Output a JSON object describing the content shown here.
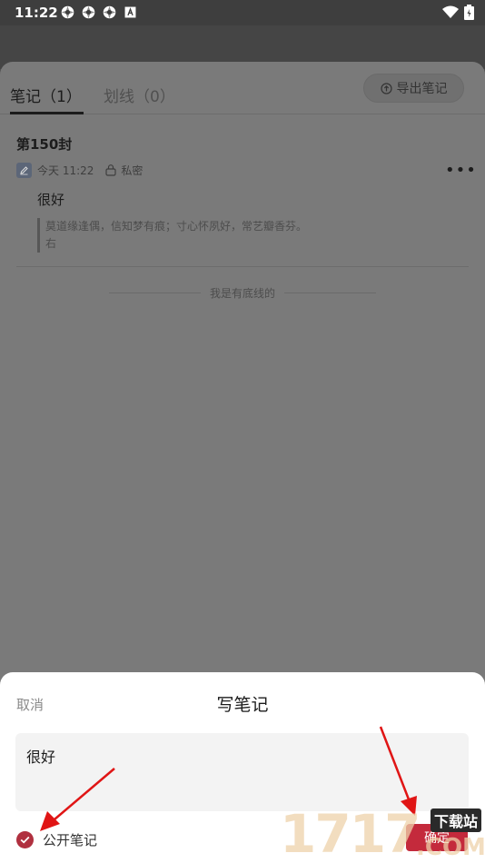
{
  "status_bar": {
    "time": "11:22"
  },
  "tabs": [
    {
      "label": "笔记（1）",
      "active": true
    },
    {
      "label": "划线（0）",
      "active": false
    }
  ],
  "export_button": {
    "label": "导出笔记",
    "icon": "export-icon"
  },
  "note": {
    "chapter": "第150封",
    "time": "今天 11:22",
    "privacy": "私密",
    "content": "很好",
    "quote_line1": "莫道缘逢偶，信知梦有痕；寸心怀夙好，常艺瓣香芬。",
    "quote_line2": "右"
  },
  "bottom_hint": "我是有底线的",
  "write_sheet": {
    "cancel": "取消",
    "title": "写笔记",
    "input_value": "很好",
    "public_label": "公开笔记",
    "public_checked": true,
    "confirm": "确定"
  },
  "watermark": {
    "digits": "1717",
    "suffix": ".COM",
    "site": "下载站"
  },
  "colors": {
    "accent": "#c42a3c",
    "check": "#b0303f",
    "arrow": "#e01515"
  }
}
